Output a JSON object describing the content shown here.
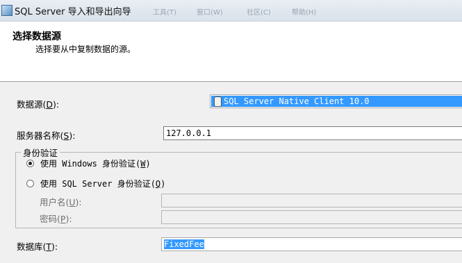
{
  "window": {
    "title": "SQL Server 导入和导出向导",
    "bg_menus": [
      "工具(T)",
      "窗口(W)",
      "社区(C)",
      "帮助(H)"
    ]
  },
  "header": {
    "title": "选择数据源",
    "subtitle": "选择要从中复制数据的源。"
  },
  "form": {
    "data_source": {
      "label": "数据源(",
      "hotkey": "D",
      "label_end": "):",
      "value": "SQL Server Native Client 10.0",
      "icon": "database-icon"
    },
    "server_name": {
      "label": "服务器名称(",
      "hotkey": "S",
      "label_end": "):",
      "value": "127.0.0.1"
    },
    "auth": {
      "group_title": "身份验证",
      "windows": {
        "label": "使用 Windows 身份验证(",
        "hotkey": "W",
        "label_end": ")",
        "checked": true
      },
      "sql": {
        "label": "使用 SQL Server 身份验证(",
        "hotkey": "Q",
        "label_end": ")",
        "checked": false
      },
      "username": {
        "label": "用户名(",
        "hotkey": "U",
        "label_end": "):",
        "value": ""
      },
      "password": {
        "label": "密码(",
        "hotkey": "P",
        "label_end": "):",
        "value": ""
      }
    },
    "database": {
      "label": "数据库(",
      "hotkey": "T",
      "label_end": "):",
      "value": "FixedFee"
    }
  },
  "colors": {
    "selection": "#3399ff",
    "header_bg": "#ffffff",
    "panel_bg": "#f0f0f0"
  }
}
